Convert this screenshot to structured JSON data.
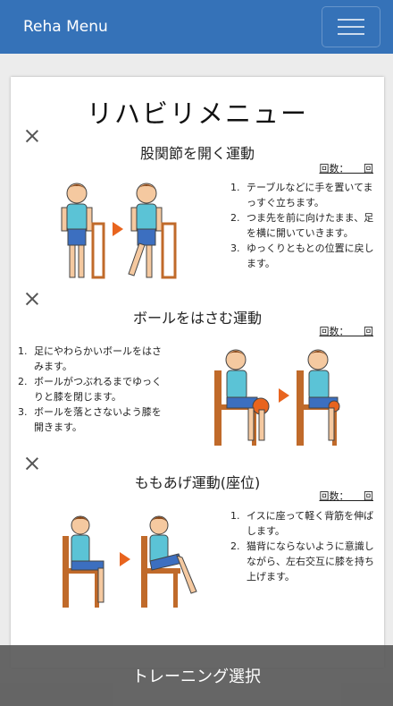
{
  "navbar": {
    "brand": "Reha Menu",
    "menu_icon": "hamburger-menu-icon"
  },
  "page": {
    "title": "リハビリメニュー"
  },
  "exercises": [
    {
      "title": "股関節を開く運動",
      "count_label": "回数：　　回",
      "steps": [
        {
          "num": "1.",
          "text": "テーブルなどに手を置いてまっすぐ立ちます。"
        },
        {
          "num": "2.",
          "text": "つま先を前に向けたまま、足を横に開いていきます。"
        },
        {
          "num": "3.",
          "text": "ゆっくりともとの位置に戻します。"
        }
      ]
    },
    {
      "title": "ボールをはさむ運動",
      "count_label": "回数：　　回",
      "steps": [
        {
          "num": "1.",
          "text": "足にやわらかいボールをはさみます。"
        },
        {
          "num": "2.",
          "text": "ボールがつぶれるまでゆっくりと膝を閉じます。"
        },
        {
          "num": "3.",
          "text": "ボールを落とさないよう膝を開きます。"
        }
      ]
    },
    {
      "title": "ももあげ運動(座位)",
      "count_label": "回数：　　回",
      "steps": [
        {
          "num": "1.",
          "text": "イスに座って軽く背筋を伸ばします。"
        },
        {
          "num": "2.",
          "text": "猫背にならないように意識しながら、左右交互に膝を持ち上げます。"
        }
      ]
    }
  ],
  "footer": {
    "label": "トレーニング選択"
  },
  "colors": {
    "navbar": "#3572b8",
    "arrow": "#e8641e",
    "shirt": "#5bc3d6",
    "shorts": "#3c6fc0"
  }
}
